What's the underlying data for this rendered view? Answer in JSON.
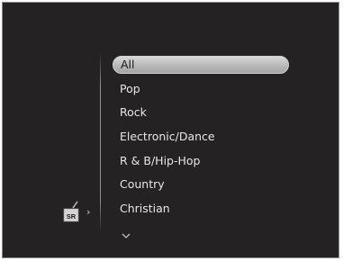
{
  "menu": {
    "items": [
      {
        "label": "All",
        "selected": true
      },
      {
        "label": "Pop",
        "selected": false
      },
      {
        "label": "Rock",
        "selected": false
      },
      {
        "label": "Electronic/Dance",
        "selected": false
      },
      {
        "label": "R & B/Hip-Hop",
        "selected": false
      },
      {
        "label": "Country",
        "selected": false
      },
      {
        "label": "Christian",
        "selected": false
      }
    ],
    "scroll_more_icon": "chevron-down-icon"
  },
  "source": {
    "label": "SR",
    "icon": "satellite-radio-icon",
    "arrow_icon": "chevron-right-icon"
  },
  "colors": {
    "background": "#242222",
    "highlight": "#c4c4c4",
    "text": "#e6e6e6"
  }
}
